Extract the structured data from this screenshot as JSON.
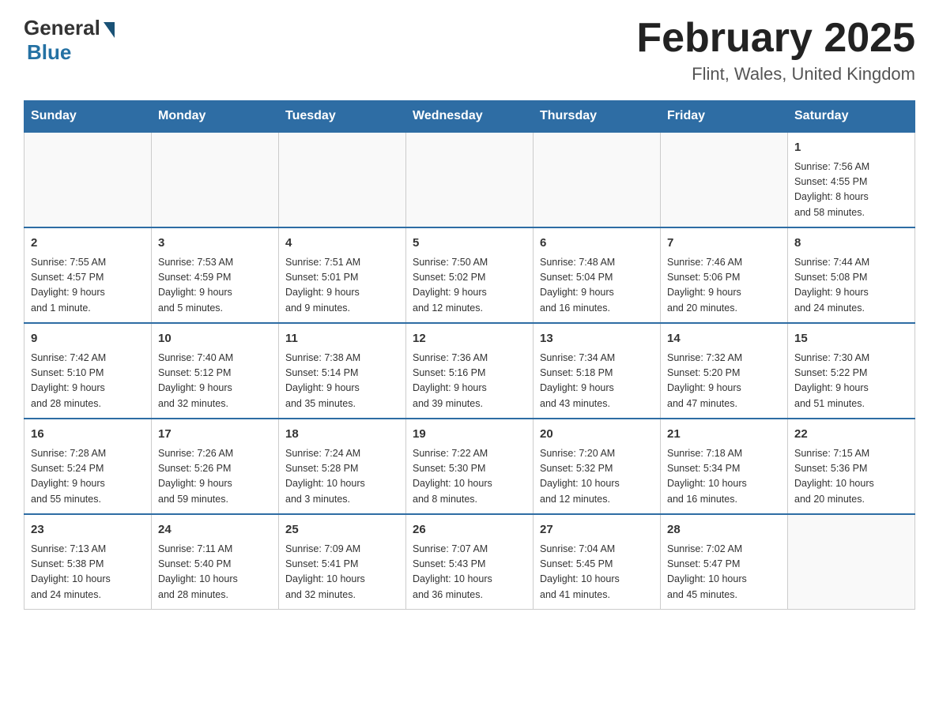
{
  "header": {
    "logo_general": "General",
    "logo_blue": "Blue",
    "month_title": "February 2025",
    "location": "Flint, Wales, United Kingdom"
  },
  "weekdays": [
    "Sunday",
    "Monday",
    "Tuesday",
    "Wednesday",
    "Thursday",
    "Friday",
    "Saturday"
  ],
  "weeks": [
    [
      {
        "day": "",
        "info": ""
      },
      {
        "day": "",
        "info": ""
      },
      {
        "day": "",
        "info": ""
      },
      {
        "day": "",
        "info": ""
      },
      {
        "day": "",
        "info": ""
      },
      {
        "day": "",
        "info": ""
      },
      {
        "day": "1",
        "info": "Sunrise: 7:56 AM\nSunset: 4:55 PM\nDaylight: 8 hours\nand 58 minutes."
      }
    ],
    [
      {
        "day": "2",
        "info": "Sunrise: 7:55 AM\nSunset: 4:57 PM\nDaylight: 9 hours\nand 1 minute."
      },
      {
        "day": "3",
        "info": "Sunrise: 7:53 AM\nSunset: 4:59 PM\nDaylight: 9 hours\nand 5 minutes."
      },
      {
        "day": "4",
        "info": "Sunrise: 7:51 AM\nSunset: 5:01 PM\nDaylight: 9 hours\nand 9 minutes."
      },
      {
        "day": "5",
        "info": "Sunrise: 7:50 AM\nSunset: 5:02 PM\nDaylight: 9 hours\nand 12 minutes."
      },
      {
        "day": "6",
        "info": "Sunrise: 7:48 AM\nSunset: 5:04 PM\nDaylight: 9 hours\nand 16 minutes."
      },
      {
        "day": "7",
        "info": "Sunrise: 7:46 AM\nSunset: 5:06 PM\nDaylight: 9 hours\nand 20 minutes."
      },
      {
        "day": "8",
        "info": "Sunrise: 7:44 AM\nSunset: 5:08 PM\nDaylight: 9 hours\nand 24 minutes."
      }
    ],
    [
      {
        "day": "9",
        "info": "Sunrise: 7:42 AM\nSunset: 5:10 PM\nDaylight: 9 hours\nand 28 minutes."
      },
      {
        "day": "10",
        "info": "Sunrise: 7:40 AM\nSunset: 5:12 PM\nDaylight: 9 hours\nand 32 minutes."
      },
      {
        "day": "11",
        "info": "Sunrise: 7:38 AM\nSunset: 5:14 PM\nDaylight: 9 hours\nand 35 minutes."
      },
      {
        "day": "12",
        "info": "Sunrise: 7:36 AM\nSunset: 5:16 PM\nDaylight: 9 hours\nand 39 minutes."
      },
      {
        "day": "13",
        "info": "Sunrise: 7:34 AM\nSunset: 5:18 PM\nDaylight: 9 hours\nand 43 minutes."
      },
      {
        "day": "14",
        "info": "Sunrise: 7:32 AM\nSunset: 5:20 PM\nDaylight: 9 hours\nand 47 minutes."
      },
      {
        "day": "15",
        "info": "Sunrise: 7:30 AM\nSunset: 5:22 PM\nDaylight: 9 hours\nand 51 minutes."
      }
    ],
    [
      {
        "day": "16",
        "info": "Sunrise: 7:28 AM\nSunset: 5:24 PM\nDaylight: 9 hours\nand 55 minutes."
      },
      {
        "day": "17",
        "info": "Sunrise: 7:26 AM\nSunset: 5:26 PM\nDaylight: 9 hours\nand 59 minutes."
      },
      {
        "day": "18",
        "info": "Sunrise: 7:24 AM\nSunset: 5:28 PM\nDaylight: 10 hours\nand 3 minutes."
      },
      {
        "day": "19",
        "info": "Sunrise: 7:22 AM\nSunset: 5:30 PM\nDaylight: 10 hours\nand 8 minutes."
      },
      {
        "day": "20",
        "info": "Sunrise: 7:20 AM\nSunset: 5:32 PM\nDaylight: 10 hours\nand 12 minutes."
      },
      {
        "day": "21",
        "info": "Sunrise: 7:18 AM\nSunset: 5:34 PM\nDaylight: 10 hours\nand 16 minutes."
      },
      {
        "day": "22",
        "info": "Sunrise: 7:15 AM\nSunset: 5:36 PM\nDaylight: 10 hours\nand 20 minutes."
      }
    ],
    [
      {
        "day": "23",
        "info": "Sunrise: 7:13 AM\nSunset: 5:38 PM\nDaylight: 10 hours\nand 24 minutes."
      },
      {
        "day": "24",
        "info": "Sunrise: 7:11 AM\nSunset: 5:40 PM\nDaylight: 10 hours\nand 28 minutes."
      },
      {
        "day": "25",
        "info": "Sunrise: 7:09 AM\nSunset: 5:41 PM\nDaylight: 10 hours\nand 32 minutes."
      },
      {
        "day": "26",
        "info": "Sunrise: 7:07 AM\nSunset: 5:43 PM\nDaylight: 10 hours\nand 36 minutes."
      },
      {
        "day": "27",
        "info": "Sunrise: 7:04 AM\nSunset: 5:45 PM\nDaylight: 10 hours\nand 41 minutes."
      },
      {
        "day": "28",
        "info": "Sunrise: 7:02 AM\nSunset: 5:47 PM\nDaylight: 10 hours\nand 45 minutes."
      },
      {
        "day": "",
        "info": ""
      }
    ]
  ]
}
